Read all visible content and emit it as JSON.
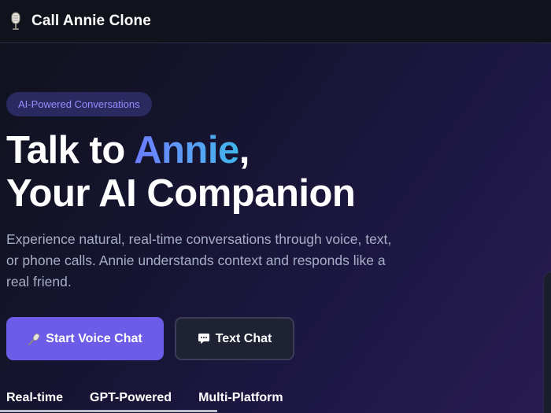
{
  "header": {
    "app_title": "Call Annie Clone",
    "logo_icon": "microphone-icon"
  },
  "hero": {
    "badge": "AI-Powered Conversations",
    "headline_prefix": "Talk to ",
    "headline_accent": "Annie",
    "headline_comma": ",",
    "headline_line2": "Your AI Companion",
    "description": "Experience natural, real-time conversations through voice, text, or phone calls. Annie understands context and responds like a real friend."
  },
  "buttons": {
    "voice_chat": {
      "label": "Start Voice Chat",
      "icon": "microphone-icon"
    },
    "text_chat": {
      "label": "Text Chat",
      "icon": "chat-bubble-icon"
    }
  },
  "features": [
    "Real-time",
    "GPT-Powered",
    "Multi-Platform"
  ],
  "colors": {
    "background": "#161432",
    "header_bg": "#10121c",
    "primary_button": "#6c5ce7",
    "secondary_button": "#1e2233",
    "badge_bg": "#2a2960",
    "badge_text": "#9a8cff",
    "accent_gradient_start": "#6c7cff",
    "accent_gradient_end": "#3fb5ea",
    "description_text": "#a7aec6"
  }
}
